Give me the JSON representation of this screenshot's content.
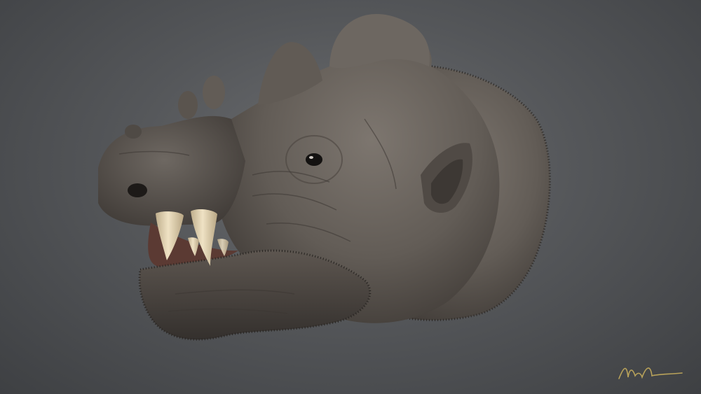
{
  "scene": {
    "subject": "creature-head-render",
    "colors": {
      "background_center": "#6b6d70",
      "background_edge": "#3e4043",
      "skin": "#6b6560",
      "skin_dark": "#3f3a36",
      "tusk": "#e3d3b0",
      "mouth": "#5b3a33",
      "signature_ink": "#b8a25a"
    }
  },
  "signature": {
    "text": ""
  }
}
